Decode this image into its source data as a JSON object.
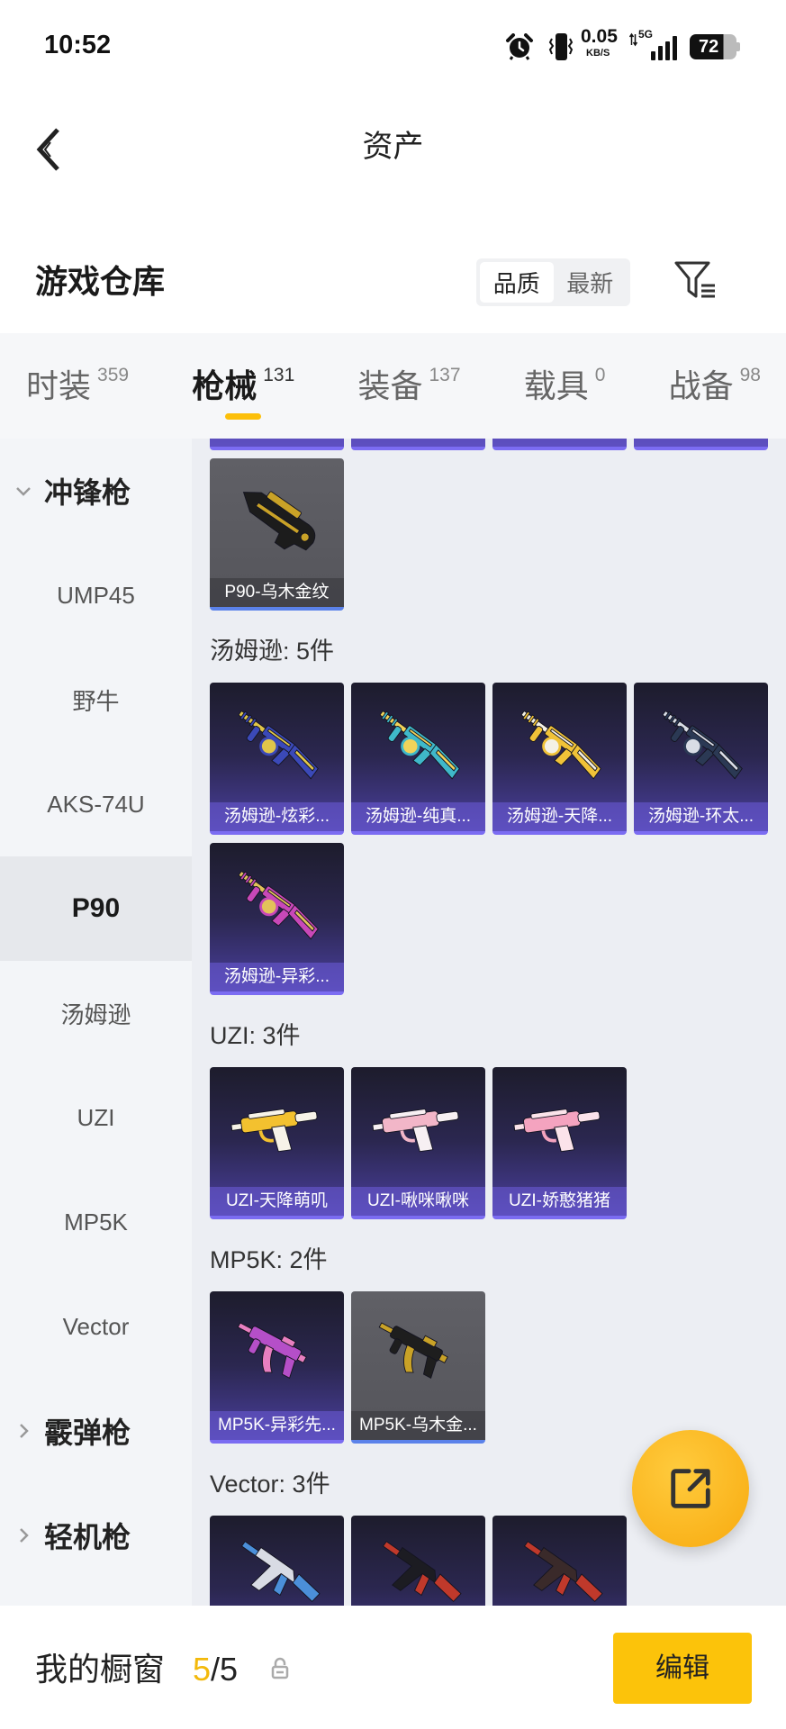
{
  "status_bar": {
    "time": "10:52",
    "net_speed": "0.05",
    "net_unit": "KB/S",
    "network": "5G",
    "battery": "72",
    "battery_level": 0.72,
    "icons": [
      "alarm-icon",
      "vibrate-icon",
      "data-arrows-icon",
      "signal-icon",
      "battery-icon"
    ]
  },
  "header": {
    "title": "资产",
    "back_icon": "back-chevron-icon"
  },
  "warehouse": {
    "title": "游戏仓库",
    "sort_options": [
      {
        "label": "品质",
        "active": true
      },
      {
        "label": "最新",
        "active": false
      }
    ],
    "filter_icon": "filter-icon"
  },
  "tabs": [
    {
      "label": "时装",
      "count": "359",
      "active": false
    },
    {
      "label": "枪械",
      "count": "131",
      "active": true
    },
    {
      "label": "装备",
      "count": "137",
      "active": false
    },
    {
      "label": "载具",
      "count": "0",
      "active": false
    },
    {
      "label": "战备",
      "count": "98",
      "active": false
    }
  ],
  "sidebar": {
    "items": [
      {
        "label": "冲锋枪",
        "category": true,
        "expanded": true,
        "icon": "chevron-down-icon"
      },
      {
        "label": "UMP45"
      },
      {
        "label": "野牛"
      },
      {
        "label": "AKS-74U"
      },
      {
        "label": "P90",
        "selected": true
      },
      {
        "label": "汤姆逊"
      },
      {
        "label": "UZI"
      },
      {
        "label": "MP5K"
      },
      {
        "label": "Vector"
      },
      {
        "label": "霰弹枪",
        "category": true,
        "expanded": false,
        "icon": "chevron-right-icon"
      },
      {
        "label": "轻机枪",
        "category": true,
        "expanded": false,
        "icon": "chevron-right-icon"
      }
    ]
  },
  "groups": [
    {
      "heading": "",
      "items": [
        {
          "name": "",
          "style": "purple",
          "icon": "p90-icon",
          "colors": [
            "#2a2a3a",
            "#8a8aa0"
          ]
        },
        {
          "name": "",
          "style": "purple",
          "icon": "p90-icon",
          "colors": [
            "#2a2a3a",
            "#8a8aa0"
          ]
        },
        {
          "name": "",
          "style": "purple",
          "icon": "p90-icon",
          "colors": [
            "#2a2a3a",
            "#8a8aa0"
          ]
        },
        {
          "name": "",
          "style": "purple",
          "icon": "p90-icon",
          "colors": [
            "#2a2a3a",
            "#8a8aa0"
          ]
        },
        {
          "name": "P90-乌木金纹",
          "style": "gray",
          "icon": "p90-icon",
          "colors": [
            "#1c1c1c",
            "#c9a227"
          ]
        }
      ]
    },
    {
      "heading": "汤姆逊: 5件",
      "items": [
        {
          "name": "汤姆逊-炫彩...",
          "style": "purple",
          "icon": "thompson-icon",
          "colors": [
            "#3b49b8",
            "#e0c64a"
          ]
        },
        {
          "name": "汤姆逊-纯真...",
          "style": "purple",
          "icon": "thompson-icon",
          "colors": [
            "#3fb8c9",
            "#f1d35a"
          ]
        },
        {
          "name": "汤姆逊-天降...",
          "style": "purple",
          "icon": "thompson-icon",
          "colors": [
            "#f0c238",
            "#f4f1e6"
          ]
        },
        {
          "name": "汤姆逊-环太...",
          "style": "purple",
          "icon": "thompson-icon",
          "colors": [
            "#2b3954",
            "#d9dde6"
          ]
        },
        {
          "name": "汤姆逊-异彩...",
          "style": "purple",
          "icon": "thompson-icon",
          "colors": [
            "#c848b8",
            "#e2c25a"
          ]
        }
      ]
    },
    {
      "heading": "UZI: 3件",
      "items": [
        {
          "name": "UZI-天降萌叽",
          "style": "purple",
          "icon": "uzi-icon",
          "colors": [
            "#f3c12f",
            "#f7f3e8"
          ]
        },
        {
          "name": "UZI-啾咪啾咪",
          "style": "purple",
          "icon": "uzi-icon",
          "colors": [
            "#f2b6c8",
            "#f7f0f3"
          ]
        },
        {
          "name": "UZI-娇憨猪猪",
          "style": "purple",
          "icon": "uzi-icon",
          "colors": [
            "#f4a3bf",
            "#fbe3ea"
          ]
        }
      ]
    },
    {
      "heading": "MP5K: 2件",
      "items": [
        {
          "name": "MP5K-异彩先...",
          "style": "purple",
          "icon": "mp5k-icon",
          "colors": [
            "#b54fc8",
            "#e87fc0"
          ]
        },
        {
          "name": "MP5K-乌木金...",
          "style": "gray",
          "icon": "mp5k-icon",
          "colors": [
            "#1e1e1e",
            "#c9a227"
          ]
        }
      ]
    },
    {
      "heading": "Vector: 3件",
      "items": [
        {
          "name": "",
          "style": "purple",
          "icon": "vector-icon",
          "colors": [
            "#d8dbe4",
            "#4b8fd9"
          ]
        },
        {
          "name": "",
          "style": "purple",
          "icon": "vector-icon",
          "colors": [
            "#1c1c22",
            "#c0392b"
          ]
        },
        {
          "name": "",
          "style": "purple",
          "icon": "vector-icon",
          "colors": [
            "#3a2a2a",
            "#c0392b"
          ]
        }
      ]
    }
  ],
  "fab": {
    "icon": "share-export-icon"
  },
  "bottom_bar": {
    "label": "我的橱窗",
    "count": "5",
    "separator": "/",
    "total": "5",
    "lock_icon": "lock-icon",
    "edit_label": "编辑"
  },
  "colors": {
    "accent": "#fcc30a",
    "count_highlight": "#f3b90b",
    "tab_underline": "#fcbf0a",
    "card_purple_border": "#7b6cf2",
    "card_gray_border": "#5b82ea"
  }
}
